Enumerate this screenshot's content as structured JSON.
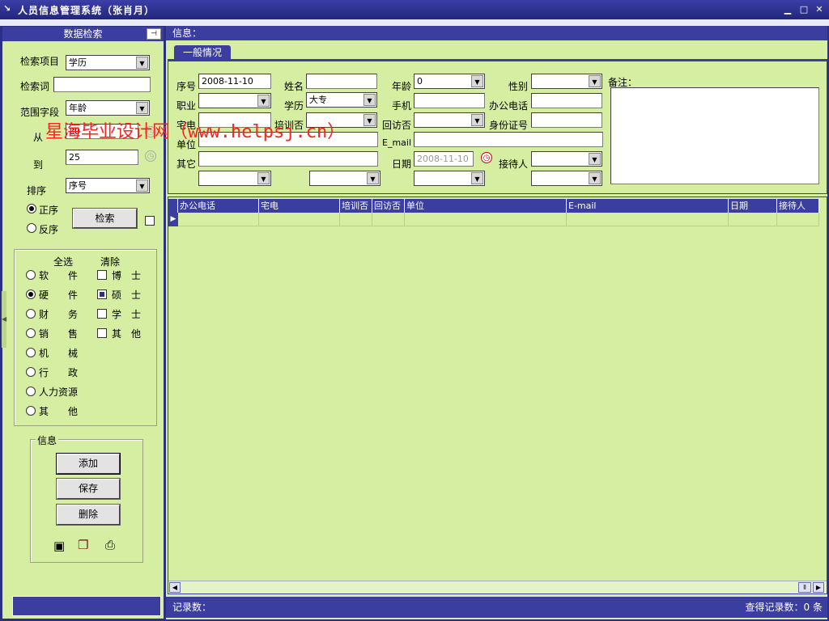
{
  "window": {
    "title": "人员信息管理系统（张肖月）"
  },
  "left": {
    "header": "数据检索",
    "search_item_label": "检索项目",
    "search_item_value": "学历",
    "search_word_label": "检索词",
    "search_word_value": "",
    "range_field_label": "范围字段",
    "range_field_value": "年龄",
    "from_label": "从",
    "from_value": "20",
    "to_label": "到",
    "to_value": "25",
    "sort_label": "排序",
    "sort_value": "序号",
    "asc_label": "正序",
    "desc_label": "反序",
    "search_button": "检索",
    "select_all": "全选",
    "clear": "清除",
    "departments": [
      "软　　件",
      "硬　　件",
      "财　　务",
      "销　　售",
      "机　　械",
      "行　　政",
      "人力资源",
      "其　　他"
    ],
    "department_selected": "硬　　件",
    "degrees": [
      "博　士",
      "硕　士",
      "学　士",
      "其　他"
    ],
    "degree_checked": "硕　士",
    "info_group": "信息",
    "add_button": "添加",
    "save_button": "保存",
    "delete_button": "删除"
  },
  "right": {
    "header": "信息：",
    "tab": "一般情况",
    "fields": {
      "seq_label": "序号",
      "seq_value": "2008-11-10",
      "name_label": "姓名",
      "name_value": "",
      "age_label": "年龄",
      "age_value": "0",
      "gender_label": "性别",
      "gender_value": "",
      "remark_label": "备注：",
      "job_label": "职业",
      "job_value": "",
      "edu_label": "学历",
      "edu_value": "大专",
      "mobile_label": "手机",
      "mobile_value": "",
      "office_phone_label": "办公电话",
      "office_phone_value": "",
      "home_phone_label": "宅电",
      "home_phone_value": "",
      "trained_label": "培训否",
      "trained_value": "",
      "visited_label": "回访否",
      "visited_value": "",
      "id_label": "身份证号",
      "id_value": "",
      "unit_label": "单位",
      "unit_value": "",
      "email_label": "E_mail",
      "email_value": "",
      "other_label": "其它",
      "other_value": "",
      "date_label": "日期",
      "date_value": "2008-11-10",
      "receiver_label": "接待人",
      "receiver_value": ""
    },
    "grid_columns": [
      "办公电话",
      "宅电",
      "培训否",
      "回访否",
      "单位",
      "E-mail",
      "日期",
      "接待人"
    ],
    "record_label": "记录数：",
    "found_label": "查得记录数：0 条"
  },
  "watermark": "星海毕业设计网（www.helpsj.cn）"
}
